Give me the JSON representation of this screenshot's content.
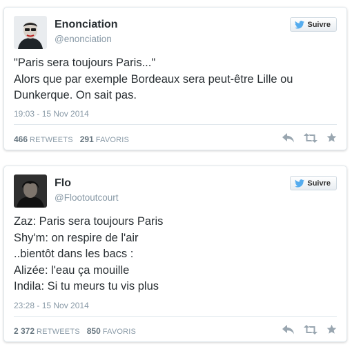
{
  "tweets": [
    {
      "name": "Enonciation",
      "handle": "@enonciation",
      "follow_label": "Suivre",
      "lines": [
        "\"Paris sera toujours Paris...\"",
        "Alors que par exemple Bordeaux sera peut-être Lille ou",
        "Dunkerque. On sait pas."
      ],
      "timestamp": "19:03 - 15 Nov 2014",
      "retweets": "466",
      "retweets_label": "RETWEETS",
      "favorites": "291",
      "favorites_label": "FAVORIS"
    },
    {
      "name": "Flo",
      "handle": "@Flootoutcourt",
      "follow_label": "Suivre",
      "lines": [
        "Zaz: Paris sera toujours Paris",
        "Shy'm: on respire de l'air",
        "..bientôt dans les bacs :",
        "Alizée: l'eau ça mouille",
        "Indila: Si tu meurs tu vis plus"
      ],
      "timestamp": "23:28 - 15 Nov 2014",
      "retweets": "2 372",
      "retweets_label": "RETWEETS",
      "favorites": "850",
      "favorites_label": "FAVORIS"
    }
  ],
  "colors": {
    "twitter_blue": "#55acee",
    "icon_gray": "#99a6b0",
    "meta_gray": "#8899a6"
  },
  "icons": {
    "follow": "twitter-bird-icon",
    "reply": "reply-icon",
    "retweet": "retweet-icon",
    "favorite": "star-icon"
  }
}
